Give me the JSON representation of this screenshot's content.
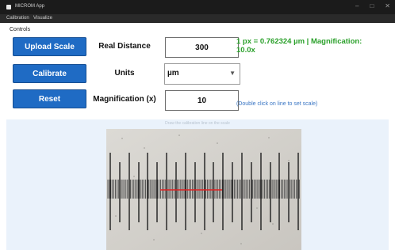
{
  "window": {
    "title": "MICROM App"
  },
  "menu": {
    "items": [
      "Calibration",
      "Visualize"
    ]
  },
  "controls": {
    "title": "Controls",
    "buttons": {
      "upload": "Upload Scale",
      "calibrate": "Calibrate",
      "reset": "Reset"
    },
    "real_distance": {
      "label": "Real Distance",
      "value": "300"
    },
    "units": {
      "label": "Units",
      "selected": "µm"
    },
    "magnification": {
      "label": "Magnification (x)",
      "value": "10"
    },
    "result": "1 px = 0.762324 µm | Magnification: 10.0x",
    "hint": "(Double click on line to set scale)"
  },
  "image": {
    "hint": "Draw the calibration line on the scale",
    "measure_line_color": "#e02020",
    "accent": "#1f6bc4",
    "result_color": "#2aa02a"
  }
}
